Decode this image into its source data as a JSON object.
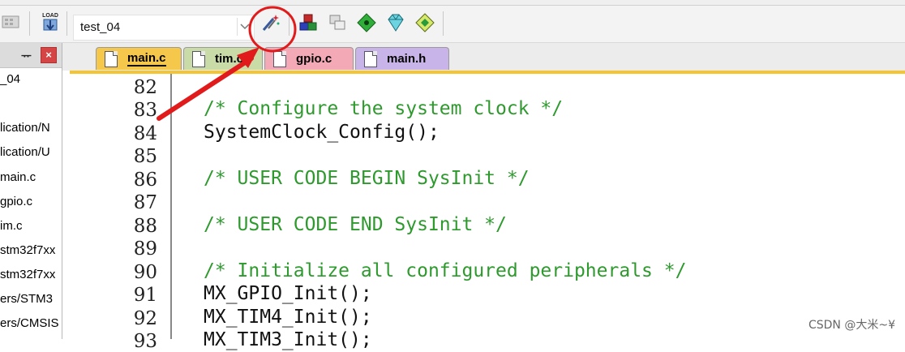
{
  "toolbar": {
    "load_label": "LOAD",
    "target_name": "test_04"
  },
  "left_panel": {
    "items": [
      "_04",
      "lication/N",
      "lication/U",
      "main.c",
      "gpio.c",
      "im.c",
      "stm32f7xx",
      "stm32f7xx",
      "ers/STM3",
      "ers/CMSIS"
    ]
  },
  "tabs": [
    {
      "label": "main.c",
      "color": "#f5c84c",
      "active": true
    },
    {
      "label": "tim.c",
      "color": "#c9dba6",
      "active": false
    },
    {
      "label": "gpio.c",
      "color": "#f4a9b6",
      "active": false
    },
    {
      "label": "main.h",
      "color": "#c8b4e8",
      "active": false
    }
  ],
  "editor": {
    "lines": [
      {
        "num": "82",
        "text": ""
      },
      {
        "num": "83",
        "text": "/* Configure the system clock */",
        "comment": true
      },
      {
        "num": "84",
        "text": "SystemClock_Config();"
      },
      {
        "num": "85",
        "text": ""
      },
      {
        "num": "86",
        "text": "/* USER CODE BEGIN SysInit */",
        "comment": true
      },
      {
        "num": "87",
        "text": ""
      },
      {
        "num": "88",
        "text": "/* USER CODE END SysInit */",
        "comment": true
      },
      {
        "num": "89",
        "text": ""
      },
      {
        "num": "90",
        "text": "/* Initialize all configured peripherals */",
        "comment": true
      },
      {
        "num": "91",
        "text": "MX_GPIO_Init();"
      },
      {
        "num": "92",
        "text": "MX_TIM4_Init();"
      },
      {
        "num": "93",
        "text": "MX_TIM3_Init();"
      }
    ]
  },
  "watermark": "CSDN @大米~¥",
  "colors": {
    "comment": "#2e9a2e",
    "annotation": "#e11b1b",
    "editor_border": "#f5c531"
  },
  "annotation": {
    "icon": "magic-wand-icon",
    "shape": "circled with red arrow"
  }
}
